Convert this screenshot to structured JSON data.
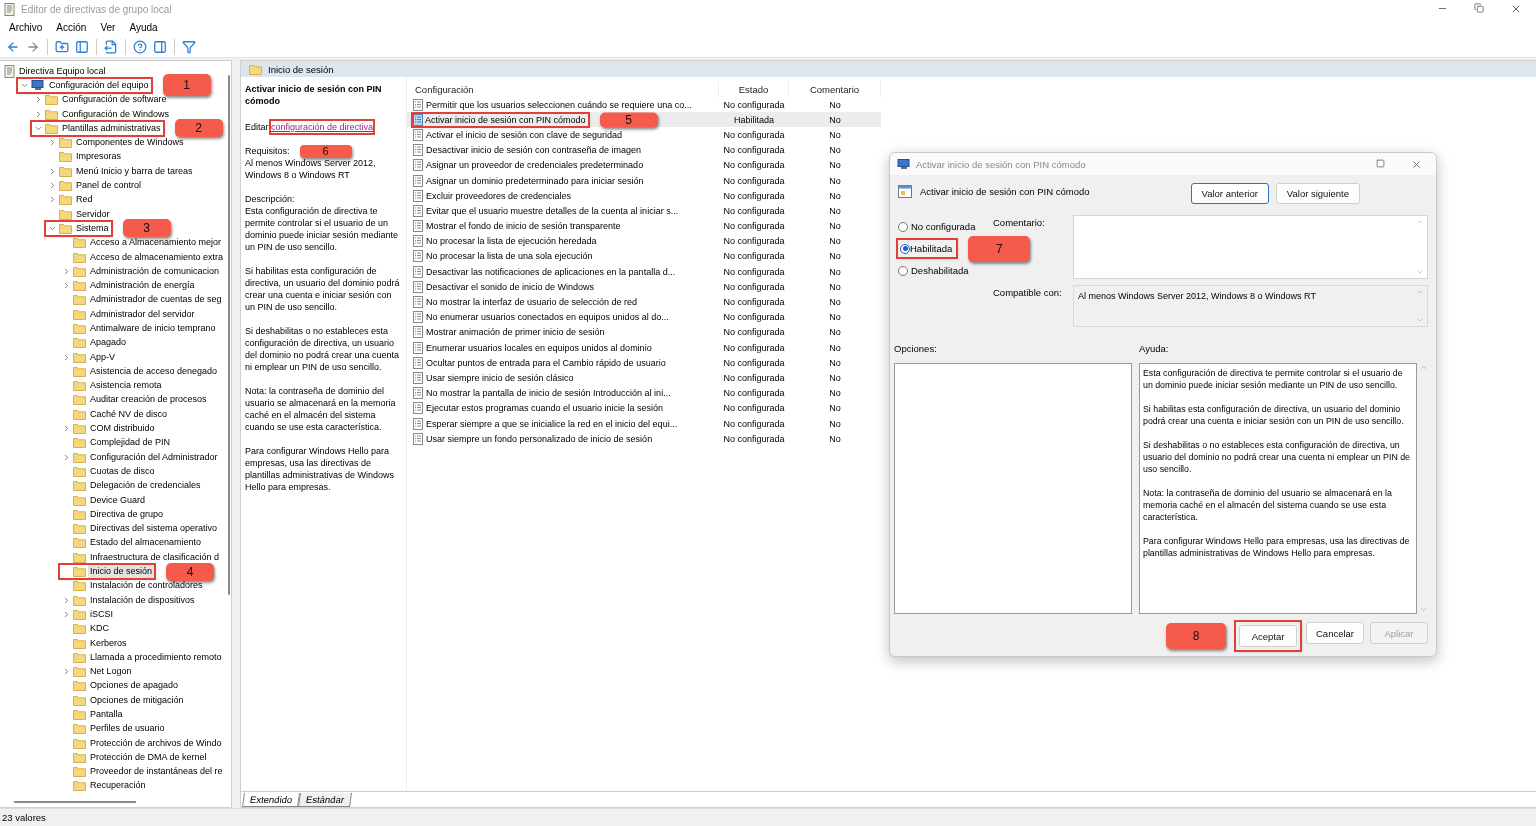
{
  "window": {
    "title": "Editor de directivas de grupo local"
  },
  "menu": [
    "Archivo",
    "Acción",
    "Ver",
    "Ayuda"
  ],
  "toolbar": [
    {
      "kind": "back",
      "disabled": false
    },
    {
      "kind": "forward",
      "disabled": true
    },
    {
      "kind": "sep"
    },
    {
      "kind": "up",
      "disabled": false
    },
    {
      "kind": "tree",
      "disabled": false
    },
    {
      "kind": "sep"
    },
    {
      "kind": "export",
      "disabled": false
    },
    {
      "kind": "sep"
    },
    {
      "kind": "help",
      "disabled": false
    },
    {
      "kind": "panel",
      "disabled": false
    },
    {
      "kind": "sep"
    },
    {
      "kind": "filter",
      "disabled": false
    }
  ],
  "tree": {
    "label": "Directiva Equipo local",
    "children": [
      {
        "label": "Configuración del equipo",
        "kind": "computer",
        "expanded": true,
        "selected": false,
        "callout": "1",
        "children": [
          {
            "label": "Configuración de software",
            "kind": "folder",
            "expanded": false,
            "selected": false
          },
          {
            "label": "Configuración de Windows",
            "kind": "folder",
            "expanded": false,
            "selected": false
          },
          {
            "label": "Plantillas administrativas",
            "kind": "folder",
            "expanded": true,
            "selected": false,
            "callout": "2",
            "children": [
              {
                "label": "Componentes de Windows",
                "kind": "folder",
                "expanded": false,
                "selected": false
              },
              {
                "label": "Impresoras",
                "kind": "folder",
                "selected": false
              },
              {
                "label": "Menú Inicio y barra de tareas",
                "kind": "folder",
                "expanded": false,
                "selected": false
              },
              {
                "label": "Panel de control",
                "kind": "folder",
                "expanded": false,
                "selected": false
              },
              {
                "label": "Red",
                "kind": "folder",
                "expanded": false,
                "selected": false
              },
              {
                "label": "Servidor",
                "kind": "folder",
                "selected": false
              },
              {
                "label": "Sistema",
                "kind": "folder",
                "expanded": true,
                "selected": false,
                "callout": "3",
                "children": [
                  {
                    "label": "Acceso a Almacenamiento mejor",
                    "kind": "folder",
                    "selected": false
                  },
                  {
                    "label": "Acceso de almacenamiento extra",
                    "kind": "folder",
                    "selected": false
                  },
                  {
                    "label": "Administración de comunicacion",
                    "kind": "folder",
                    "expanded": false,
                    "selected": false
                  },
                  {
                    "label": "Administración de energía",
                    "kind": "folder",
                    "expanded": false,
                    "selected": false
                  },
                  {
                    "label": "Administrador de cuentas de seg",
                    "kind": "folder",
                    "selected": false
                  },
                  {
                    "label": "Administrador del servidor",
                    "kind": "folder",
                    "selected": false
                  },
                  {
                    "label": "Antimalware de inicio temprano",
                    "kind": "folder",
                    "selected": false
                  },
                  {
                    "label": "Apagado",
                    "kind": "folder",
                    "selected": false
                  },
                  {
                    "label": "App-V",
                    "kind": "folder",
                    "expanded": false,
                    "selected": false
                  },
                  {
                    "label": "Asistencia de acceso denegado",
                    "kind": "folder",
                    "selected": false
                  },
                  {
                    "label": "Asistencia remota",
                    "kind": "folder",
                    "selected": false
                  },
                  {
                    "label": "Auditar creación de procesos",
                    "kind": "folder",
                    "selected": false
                  },
                  {
                    "label": "Caché NV de disco",
                    "kind": "folder",
                    "selected": false
                  },
                  {
                    "label": "COM distribuido",
                    "kind": "folder",
                    "expanded": false,
                    "selected": false
                  },
                  {
                    "label": "Complejidad de PIN",
                    "kind": "folder",
                    "selected": false
                  },
                  {
                    "label": "Configuración del Administrador",
                    "kind": "folder",
                    "expanded": false,
                    "selected": false
                  },
                  {
                    "label": "Cuotas de disco",
                    "kind": "folder",
                    "selected": false
                  },
                  {
                    "label": "Delegación de credenciales",
                    "kind": "folder",
                    "selected": false
                  },
                  {
                    "label": "Device Guard",
                    "kind": "folder",
                    "selected": false
                  },
                  {
                    "label": "Directiva de grupo",
                    "kind": "folder",
                    "selected": false
                  },
                  {
                    "label": "Directivas del sistema operativo",
                    "kind": "folder",
                    "selected": false
                  },
                  {
                    "label": "Estado del almacenamiento",
                    "kind": "folder",
                    "selected": false
                  },
                  {
                    "label": "Infraestructura de clasificación d",
                    "kind": "folder",
                    "selected": false
                  },
                  {
                    "label": "Inicio de sesión",
                    "kind": "folder",
                    "selected": true,
                    "callout": "4"
                  },
                  {
                    "label": "Instalación de controladores",
                    "kind": "folder",
                    "selected": false
                  },
                  {
                    "label": "Instalación de dispositivos",
                    "kind": "folder",
                    "expanded": false,
                    "selected": false
                  },
                  {
                    "label": "iSCSI",
                    "kind": "folder",
                    "expanded": false,
                    "selected": false
                  },
                  {
                    "label": "KDC",
                    "kind": "folder",
                    "selected": false
                  },
                  {
                    "label": "Kerberos",
                    "kind": "folder",
                    "selected": false
                  },
                  {
                    "label": "Llamada a procedimiento remoto",
                    "kind": "folder",
                    "selected": false
                  },
                  {
                    "label": "Net Logon",
                    "kind": "folder",
                    "expanded": false,
                    "selected": false
                  },
                  {
                    "label": "Opciones de apagado",
                    "kind": "folder",
                    "selected": false
                  },
                  {
                    "label": "Opciones de mitigación",
                    "kind": "folder",
                    "selected": false
                  },
                  {
                    "label": "Pantalla",
                    "kind": "folder",
                    "selected": false
                  },
                  {
                    "label": "Perfiles de usuario",
                    "kind": "folder",
                    "selected": false
                  },
                  {
                    "label": "Protección de archivos de Windo",
                    "kind": "folder",
                    "selected": false
                  },
                  {
                    "label": "Protección de DMA de kernel",
                    "kind": "folder",
                    "selected": false
                  },
                  {
                    "label": "Proveedor de instantáneas del re",
                    "kind": "folder",
                    "selected": false
                  },
                  {
                    "label": "Recuperación",
                    "kind": "folder",
                    "selected": false
                  }
                ]
              }
            ]
          }
        ]
      }
    ]
  },
  "pane_header": "Inicio de sesión",
  "description": {
    "title": "Activar inicio de sesión con PIN cómodo",
    "edit_prefix": "Editar",
    "edit_link": "configuración de directiva",
    "link_callout": "6",
    "requirements_label": "Requisitos:",
    "requirements": "Al menos Windows Server 2012, Windows 8 o Windows RT",
    "description_label": "Descripción:",
    "paragraphs": [
      "Esta configuración de directiva te permite controlar si el usuario de un dominio puede iniciar sesión mediante un PIN de uso sencillo.",
      "Si habilitas esta configuración de directiva, un usuario del dominio podrá crear una cuenta e iniciar sesión con un PIN de uso sencillo.",
      "Si deshabilitas o no estableces esta configuración de directiva, un usuario del dominio no podrá crear una cuenta ni emplear un PIN de uso sencillo.",
      "Nota: la contraseña de dominio del usuario se almacenará en la memoria caché en el almacén del sistema cuando se use esta característica.",
      "Para configurar Windows Hello para empresas, usa las directivas de plantillas administrativas de Windows Hello para empresas."
    ]
  },
  "table": {
    "columns": [
      "Configuración",
      "Estado",
      "Comentario"
    ],
    "rows": [
      {
        "setting": "Permitir que los usuarios seleccionen cuándo se requiere una co...",
        "state": "No configurada",
        "comment": "No",
        "selected": false
      },
      {
        "setting": "Activar inicio de sesión con PIN cómodo",
        "state": "Habilitada",
        "comment": "No",
        "selected": true,
        "callout": "5"
      },
      {
        "setting": "Activar el inicio de sesión con clave de seguridad",
        "state": "No configurada",
        "comment": "No",
        "selected": false
      },
      {
        "setting": "Desactivar inicio de sesión con contraseña de imagen",
        "state": "No configurada",
        "comment": "No",
        "selected": false
      },
      {
        "setting": "Asignar un proveedor de credenciales predeterminado",
        "state": "No configurada",
        "comment": "No",
        "selected": false
      },
      {
        "setting": "Asignar un dominio predeterminado para iniciar sesión",
        "state": "No configurada",
        "comment": "No",
        "selected": false
      },
      {
        "setting": "Excluir proveedores de credenciales",
        "state": "No configurada",
        "comment": "No",
        "selected": false
      },
      {
        "setting": "Evitar que el usuario muestre detalles de la cuenta al iniciar s...",
        "state": "No configurada",
        "comment": "No",
        "selected": false
      },
      {
        "setting": "Mostrar el fondo de inicio de sesión transparente",
        "state": "No configurada",
        "comment": "No",
        "selected": false
      },
      {
        "setting": "No procesar la lista de ejecución heredada",
        "state": "No configurada",
        "comment": "No",
        "selected": false
      },
      {
        "setting": "No procesar la lista de una sola ejecución",
        "state": "No configurada",
        "comment": "No",
        "selected": false
      },
      {
        "setting": "Desactivar las notificaciones de aplicaciones en la pantalla d...",
        "state": "No configurada",
        "comment": "No",
        "selected": false
      },
      {
        "setting": "Desactivar el sonido de inicio de Windows",
        "state": "No configurada",
        "comment": "No",
        "selected": false
      },
      {
        "setting": "No mostrar la interfaz de usuario de selección de red",
        "state": "No configurada",
        "comment": "No",
        "selected": false
      },
      {
        "setting": "No enumerar usuarios conectados en equipos unidos al do...",
        "state": "No configurada",
        "comment": "No",
        "selected": false
      },
      {
        "setting": "Mostrar animación de primer inicio de sesión",
        "state": "No configurada",
        "comment": "No",
        "selected": false
      },
      {
        "setting": "Enumerar usuarios locales en equipos unidos al dominio",
        "state": "No configurada",
        "comment": "No",
        "selected": false
      },
      {
        "setting": "Ocultar puntos de entrada para el Cambio rápido de usuario",
        "state": "No configurada",
        "comment": "No",
        "selected": false
      },
      {
        "setting": "Usar siempre inicio de sesión clásico",
        "state": "No configurada",
        "comment": "No",
        "selected": false
      },
      {
        "setting": "No mostrar la pantalla de inicio de sesión Introducción al ini...",
        "state": "No configurada",
        "comment": "No",
        "selected": false
      },
      {
        "setting": "Ejecutar estos programas cuando el usuario inicie la sesión",
        "state": "No configurada",
        "comment": "No",
        "selected": false
      },
      {
        "setting": "Esperar siempre a que se inicialice la red en el inicio del equi...",
        "state": "No configurada",
        "comment": "No",
        "selected": false
      },
      {
        "setting": "Usar siempre un fondo personalizado de inicio de sesión",
        "state": "No configurada",
        "comment": "No",
        "selected": false
      }
    ]
  },
  "view_tabs": [
    {
      "label": "Extendido",
      "selected": true
    },
    {
      "label": "Estándar",
      "selected": false
    }
  ],
  "status_bar": "23 valores",
  "dialog": {
    "title": "Activar inicio de sesión con PIN cómodo",
    "setting_name": "Activar inicio de sesión con PIN cómodo",
    "nav_buttons": [
      {
        "label": "Valor anterior",
        "focused": true
      },
      {
        "label": "Valor siguiente",
        "focused": false
      }
    ],
    "radios": [
      {
        "label": "No configurada",
        "selected": false
      },
      {
        "label": "Habilitada",
        "selected": true,
        "callout": "7"
      },
      {
        "label": "Deshabilitada",
        "selected": false
      }
    ],
    "comment_label": "Comentario:",
    "compatible_label": "Compatible con:",
    "compatible_value": "Al menos Windows Server 2012, Windows 8 o Windows RT",
    "options_label": "Opciones:",
    "help_label": "Ayuda:",
    "help_paragraphs": [
      "Esta configuración de directiva te permite controlar si el usuario de un dominio puede iniciar sesión mediante un PIN de uso sencillo.",
      "Si habilitas esta configuración de directiva, un usuario del dominio podrá crear una cuenta e iniciar sesión con un PIN de uso sencillo.",
      "Si deshabilitas o no estableces esta configuración de directiva, un usuario del dominio no podrá crear una cuenta ni emplear un PIN de uso sencillo.",
      "Nota: la contraseña de dominio del usuario se almacenará en la memoria caché en el almacén del sistema cuando se use esta característica.",
      "Para configurar Windows Hello para empresas, usa las directivas de plantillas administrativas de Windows Hello para empresas."
    ],
    "buttons": [
      {
        "label": "Aceptar",
        "disabled": false,
        "callout": "8"
      },
      {
        "label": "Cancelar",
        "disabled": false
      },
      {
        "label": "Aplicar",
        "disabled": true
      }
    ]
  }
}
